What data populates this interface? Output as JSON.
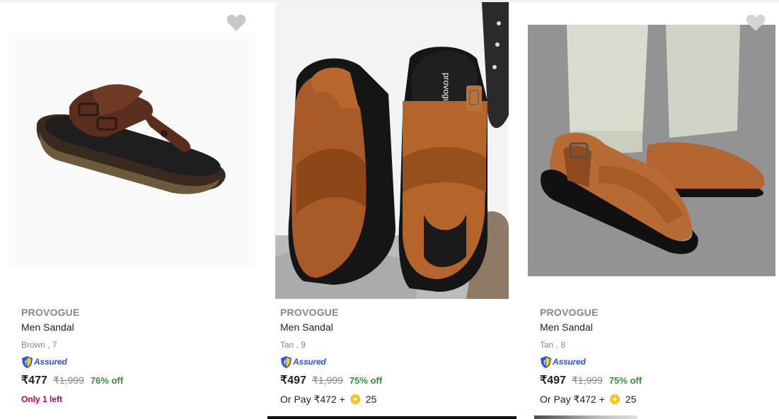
{
  "products": [
    {
      "brand": "PROVOGUE",
      "title": "Men Sandal",
      "variant": "Brown , 7",
      "assured_label": "Assured",
      "price": "₹477",
      "mrp": "₹1,999",
      "discount": "76% off",
      "stock_note": "Only 1 left",
      "wishlist_icon": "heart-icon",
      "image": "brown-leather-slipper-sandal"
    },
    {
      "brand": "PROVOGUE",
      "title": "Men Sandal",
      "variant": "Tan , 9",
      "assured_label": "Assured",
      "price": "₹497",
      "mrp": "₹1,999",
      "discount": "75% off",
      "or_pay": "Or Pay ₹472 +",
      "coins": "25",
      "insole_brand": "provogue",
      "image": "tan-peshawari-sandal-pair"
    },
    {
      "brand": "PROVOGUE",
      "title": "Men Sandal",
      "variant": "Tan , 8",
      "assured_label": "Assured",
      "price": "₹497",
      "mrp": "₹1,999",
      "discount": "75% off",
      "or_pay": "Or Pay ₹472 +",
      "coins": "25",
      "wishlist_icon": "heart-icon",
      "image": "tan-peshawari-sandal-worn"
    }
  ],
  "colors": {
    "brand_grey": "#878787",
    "discount_green": "#388e3c",
    "stock_pink": "#c70055",
    "assured_blue": "#2a55e5",
    "coin_yellow": "#f5c518"
  }
}
